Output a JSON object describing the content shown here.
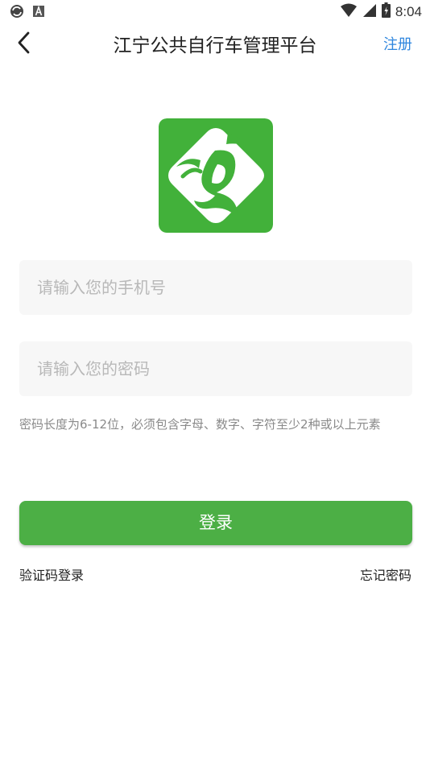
{
  "status_bar": {
    "time": "8:04",
    "icons": [
      "sync-icon",
      "a-icon",
      "wifi-icon",
      "signal-icon",
      "battery-icon"
    ]
  },
  "nav": {
    "title": "江宁公共自行车管理平台",
    "register_label": "注册",
    "back_icon": "chevron-left-icon"
  },
  "logo": {
    "icon": "bike-logo-icon",
    "color": "#42b13a"
  },
  "form": {
    "phone_placeholder": "请输入您的手机号",
    "phone_value": "",
    "password_placeholder": "请输入您的密码",
    "password_value": "",
    "hint": "密码长度为6-12位，必须包含字母、数字、字符至少2种或以上元素",
    "login_label": "登录",
    "sms_login_label": "验证码登录",
    "forgot_label": "忘记密码"
  },
  "colors": {
    "accent": "#4caf45",
    "link": "#2e86de",
    "field_bg": "#f7f7f7"
  }
}
